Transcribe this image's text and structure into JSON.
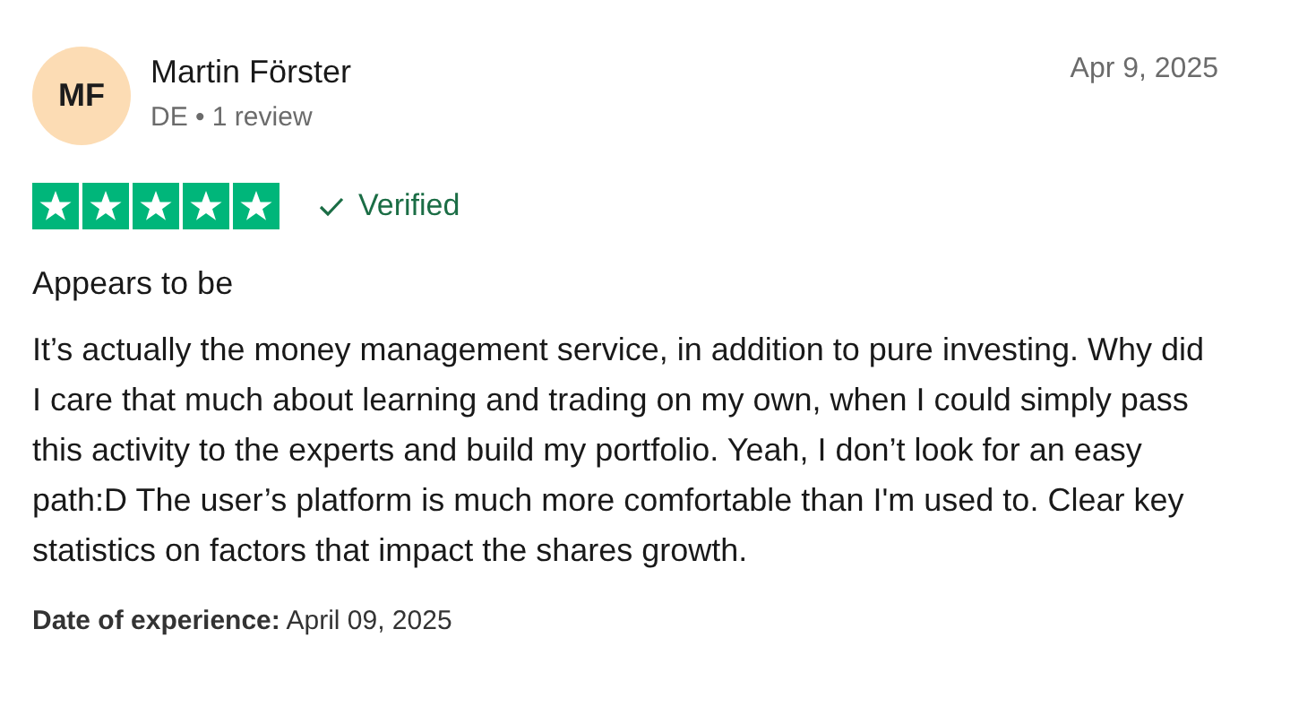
{
  "reviewer": {
    "initials": "MF",
    "name": "Martin Förster",
    "meta": "DE • 1 review"
  },
  "date": "Apr 9, 2025",
  "stars": 5,
  "verified": "Verified",
  "title": "Appears to be",
  "body": "It’s actually the money management service, in addition to pure investing. Why did I care that much about learning and trading on my own, when I could simply pass this activity to the experts and build my portfolio. Yeah, I don’t look for an easy path:D The user’s platform is much more comfortable than I'm used to. Clear key statistics on factors that impact the shares growth.",
  "experience": "**Date of experience:** April 09, 2025"
}
